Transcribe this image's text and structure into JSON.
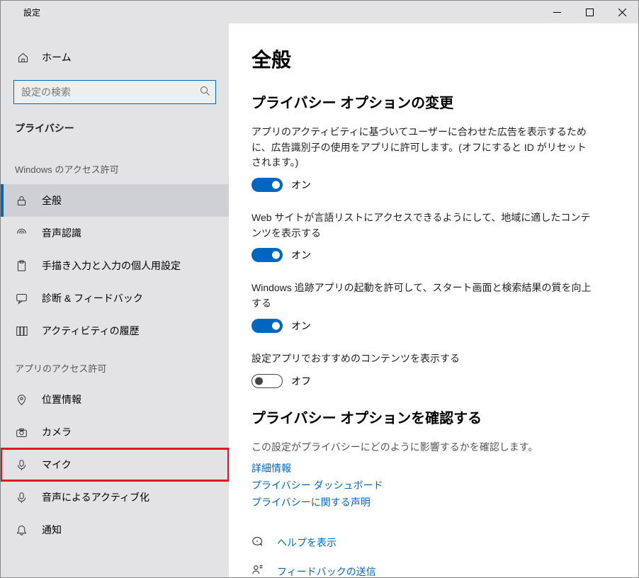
{
  "titlebar": {
    "title": "設定"
  },
  "sidebar": {
    "home": "ホーム",
    "search_placeholder": "設定の検索",
    "category": "プライバシー",
    "section_windows": "Windows のアクセス許可",
    "items_windows": [
      {
        "label": "全般"
      },
      {
        "label": "音声認識"
      },
      {
        "label": "手描き入力と入力の個人用設定"
      },
      {
        "label": "診断 & フィードバック"
      },
      {
        "label": "アクティビティの履歴"
      }
    ],
    "section_apps": "アプリのアクセス許可",
    "items_apps": [
      {
        "label": "位置情報"
      },
      {
        "label": "カメラ"
      },
      {
        "label": "マイク"
      },
      {
        "label": "音声によるアクティブ化"
      },
      {
        "label": "通知"
      }
    ]
  },
  "content": {
    "page_title": "全般",
    "section1_title": "プライバシー オプションの変更",
    "opts": [
      {
        "desc": "アプリのアクティビティに基づいてユーザーに合わせた広告を表示するために、広告識別子の使用をアプリに許可します。(オフにすると ID がリセットされます。)",
        "on": true,
        "state": "オン"
      },
      {
        "desc": "Web サイトが言語リストにアクセスできるようにして、地域に適したコンテンツを表示する",
        "on": true,
        "state": "オン"
      },
      {
        "desc": "Windows 追跡アプリの起動を許可して、スタート画面と検索結果の質を向上する",
        "on": true,
        "state": "オン"
      },
      {
        "desc": "設定アプリでおすすめのコンテンツを表示する",
        "on": false,
        "state": "オフ"
      }
    ],
    "section2_title": "プライバシー オプションを確認する",
    "section2_sub": "この設定がプライバシーにどのように影響するかを確認します。",
    "links": [
      "詳細情報",
      "プライバシー ダッシュボード",
      "プライバシーに関する声明"
    ],
    "help_label": "ヘルプを表示",
    "feedback_label": "フィードバックの送信"
  }
}
